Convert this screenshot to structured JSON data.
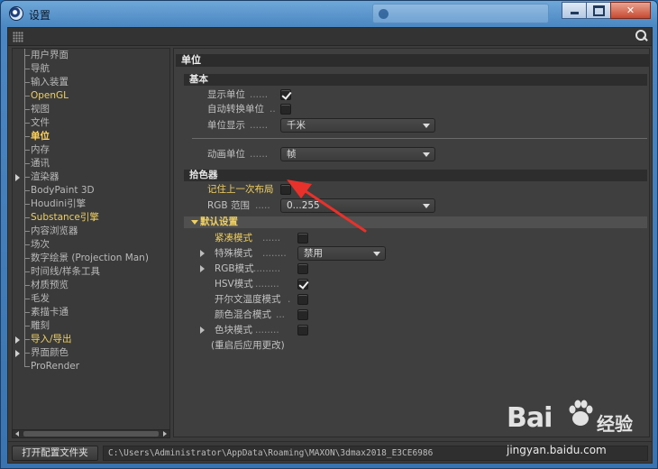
{
  "window": {
    "title": "设置"
  },
  "tree": {
    "items": [
      {
        "label": "用户界面",
        "state": "normal"
      },
      {
        "label": "导航",
        "state": "normal"
      },
      {
        "label": "输入装置",
        "state": "normal"
      },
      {
        "label": "OpenGL",
        "state": "highlight"
      },
      {
        "label": "视图",
        "state": "normal"
      },
      {
        "label": "文件",
        "state": "normal"
      },
      {
        "label": "单位",
        "state": "selected"
      },
      {
        "label": "内存",
        "state": "normal"
      },
      {
        "label": "通讯",
        "state": "normal"
      },
      {
        "label": "渲染器",
        "state": "normal",
        "expandable": true
      },
      {
        "label": "BodyPaint 3D",
        "state": "normal"
      },
      {
        "label": "Houdini引擎",
        "state": "normal"
      },
      {
        "label": "Substance引擎",
        "state": "highlight"
      },
      {
        "label": "内容浏览器",
        "state": "normal"
      },
      {
        "label": "场次",
        "state": "normal"
      },
      {
        "label": "数字绘景 (Projection Man)",
        "state": "normal"
      },
      {
        "label": "时间线/样条工具",
        "state": "normal"
      },
      {
        "label": "材质预览",
        "state": "normal"
      },
      {
        "label": "毛发",
        "state": "normal"
      },
      {
        "label": "素描卡通",
        "state": "normal"
      },
      {
        "label": "雕刻",
        "state": "normal"
      },
      {
        "label": "导入/导出",
        "state": "highlight",
        "expandable": true
      },
      {
        "label": "界面颜色",
        "state": "normal",
        "expandable": true
      },
      {
        "label": "ProRender",
        "state": "normal"
      }
    ]
  },
  "panel": {
    "title": "单位",
    "basic": {
      "header": "基本",
      "show_units": {
        "label": "显示单位",
        "checked": true
      },
      "auto_convert": {
        "label": "自动转换单位",
        "checked": false
      },
      "unit_display": {
        "label": "单位显示",
        "value": "千米"
      },
      "anim_units": {
        "label": "动画单位",
        "value": "帧"
      }
    },
    "color_picker": {
      "header": "拾色器",
      "remember_layout": {
        "label": "记住上一次布局",
        "checked": false
      },
      "rgb_range": {
        "label": "RGB 范围",
        "value": "0...255"
      }
    },
    "defaults": {
      "header": "默认设置",
      "compact_mode": {
        "label": "紧凑模式",
        "checked": false
      },
      "special_mode": {
        "label": "特殊模式",
        "value": "禁用"
      },
      "rgb_mode": {
        "label": "RGB模式",
        "checked": false
      },
      "hsv_mode": {
        "label": "HSV模式",
        "checked": true
      },
      "kelvin_mode": {
        "label": "开尔文温度模式",
        "checked": false
      },
      "color_mix_mode": {
        "label": "颜色混合模式",
        "checked": false
      },
      "swatch_mode": {
        "label": "色块模式",
        "checked": false
      },
      "restart_note": "(重启后应用更改)"
    }
  },
  "bottom": {
    "open_button": "打开配置文件夹",
    "path": "C:\\Users\\Administrator\\AppData\\Roaming\\MAXON\\3dmax2018_E3CE6986"
  },
  "watermark": {
    "logo": "Bai",
    "logo_suffix": "经验",
    "url": "jingyan.baidu.com"
  },
  "colors": {
    "highlight": "#f0d061",
    "annotation_arrow": "#e8312a",
    "panel_bg": "#3f3f3f"
  }
}
